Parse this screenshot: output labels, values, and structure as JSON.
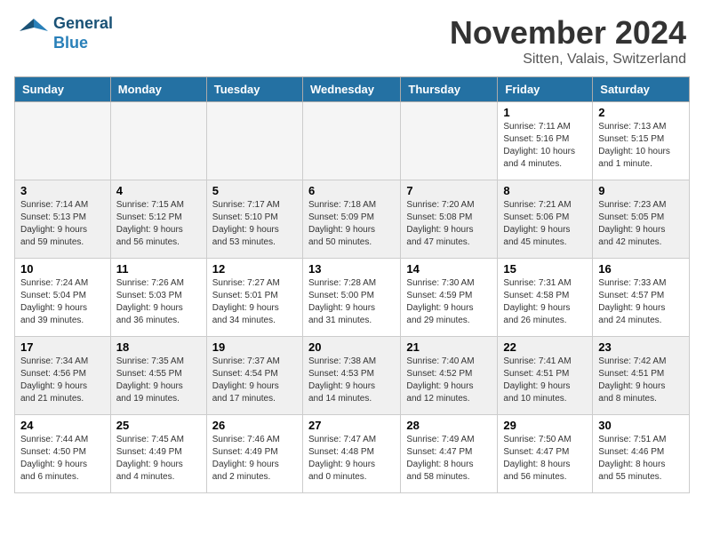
{
  "header": {
    "logo_line1": "General",
    "logo_line2": "Blue",
    "month_title": "November 2024",
    "location": "Sitten, Valais, Switzerland"
  },
  "days_of_week": [
    "Sunday",
    "Monday",
    "Tuesday",
    "Wednesday",
    "Thursday",
    "Friday",
    "Saturday"
  ],
  "weeks": [
    [
      {
        "day": "",
        "info": "",
        "empty": true
      },
      {
        "day": "",
        "info": "",
        "empty": true
      },
      {
        "day": "",
        "info": "",
        "empty": true
      },
      {
        "day": "",
        "info": "",
        "empty": true
      },
      {
        "day": "",
        "info": "",
        "empty": true
      },
      {
        "day": "1",
        "info": "Sunrise: 7:11 AM\nSunset: 5:16 PM\nDaylight: 10 hours\nand 4 minutes."
      },
      {
        "day": "2",
        "info": "Sunrise: 7:13 AM\nSunset: 5:15 PM\nDaylight: 10 hours\nand 1 minute."
      }
    ],
    [
      {
        "day": "3",
        "info": "Sunrise: 7:14 AM\nSunset: 5:13 PM\nDaylight: 9 hours\nand 59 minutes."
      },
      {
        "day": "4",
        "info": "Sunrise: 7:15 AM\nSunset: 5:12 PM\nDaylight: 9 hours\nand 56 minutes."
      },
      {
        "day": "5",
        "info": "Sunrise: 7:17 AM\nSunset: 5:10 PM\nDaylight: 9 hours\nand 53 minutes."
      },
      {
        "day": "6",
        "info": "Sunrise: 7:18 AM\nSunset: 5:09 PM\nDaylight: 9 hours\nand 50 minutes."
      },
      {
        "day": "7",
        "info": "Sunrise: 7:20 AM\nSunset: 5:08 PM\nDaylight: 9 hours\nand 47 minutes."
      },
      {
        "day": "8",
        "info": "Sunrise: 7:21 AM\nSunset: 5:06 PM\nDaylight: 9 hours\nand 45 minutes."
      },
      {
        "day": "9",
        "info": "Sunrise: 7:23 AM\nSunset: 5:05 PM\nDaylight: 9 hours\nand 42 minutes."
      }
    ],
    [
      {
        "day": "10",
        "info": "Sunrise: 7:24 AM\nSunset: 5:04 PM\nDaylight: 9 hours\nand 39 minutes."
      },
      {
        "day": "11",
        "info": "Sunrise: 7:26 AM\nSunset: 5:03 PM\nDaylight: 9 hours\nand 36 minutes."
      },
      {
        "day": "12",
        "info": "Sunrise: 7:27 AM\nSunset: 5:01 PM\nDaylight: 9 hours\nand 34 minutes."
      },
      {
        "day": "13",
        "info": "Sunrise: 7:28 AM\nSunset: 5:00 PM\nDaylight: 9 hours\nand 31 minutes."
      },
      {
        "day": "14",
        "info": "Sunrise: 7:30 AM\nSunset: 4:59 PM\nDaylight: 9 hours\nand 29 minutes."
      },
      {
        "day": "15",
        "info": "Sunrise: 7:31 AM\nSunset: 4:58 PM\nDaylight: 9 hours\nand 26 minutes."
      },
      {
        "day": "16",
        "info": "Sunrise: 7:33 AM\nSunset: 4:57 PM\nDaylight: 9 hours\nand 24 minutes."
      }
    ],
    [
      {
        "day": "17",
        "info": "Sunrise: 7:34 AM\nSunset: 4:56 PM\nDaylight: 9 hours\nand 21 minutes."
      },
      {
        "day": "18",
        "info": "Sunrise: 7:35 AM\nSunset: 4:55 PM\nDaylight: 9 hours\nand 19 minutes."
      },
      {
        "day": "19",
        "info": "Sunrise: 7:37 AM\nSunset: 4:54 PM\nDaylight: 9 hours\nand 17 minutes."
      },
      {
        "day": "20",
        "info": "Sunrise: 7:38 AM\nSunset: 4:53 PM\nDaylight: 9 hours\nand 14 minutes."
      },
      {
        "day": "21",
        "info": "Sunrise: 7:40 AM\nSunset: 4:52 PM\nDaylight: 9 hours\nand 12 minutes."
      },
      {
        "day": "22",
        "info": "Sunrise: 7:41 AM\nSunset: 4:51 PM\nDaylight: 9 hours\nand 10 minutes."
      },
      {
        "day": "23",
        "info": "Sunrise: 7:42 AM\nSunset: 4:51 PM\nDaylight: 9 hours\nand 8 minutes."
      }
    ],
    [
      {
        "day": "24",
        "info": "Sunrise: 7:44 AM\nSunset: 4:50 PM\nDaylight: 9 hours\nand 6 minutes."
      },
      {
        "day": "25",
        "info": "Sunrise: 7:45 AM\nSunset: 4:49 PM\nDaylight: 9 hours\nand 4 minutes."
      },
      {
        "day": "26",
        "info": "Sunrise: 7:46 AM\nSunset: 4:49 PM\nDaylight: 9 hours\nand 2 minutes."
      },
      {
        "day": "27",
        "info": "Sunrise: 7:47 AM\nSunset: 4:48 PM\nDaylight: 9 hours\nand 0 minutes."
      },
      {
        "day": "28",
        "info": "Sunrise: 7:49 AM\nSunset: 4:47 PM\nDaylight: 8 hours\nand 58 minutes."
      },
      {
        "day": "29",
        "info": "Sunrise: 7:50 AM\nSunset: 4:47 PM\nDaylight: 8 hours\nand 56 minutes."
      },
      {
        "day": "30",
        "info": "Sunrise: 7:51 AM\nSunset: 4:46 PM\nDaylight: 8 hours\nand 55 minutes."
      }
    ]
  ]
}
